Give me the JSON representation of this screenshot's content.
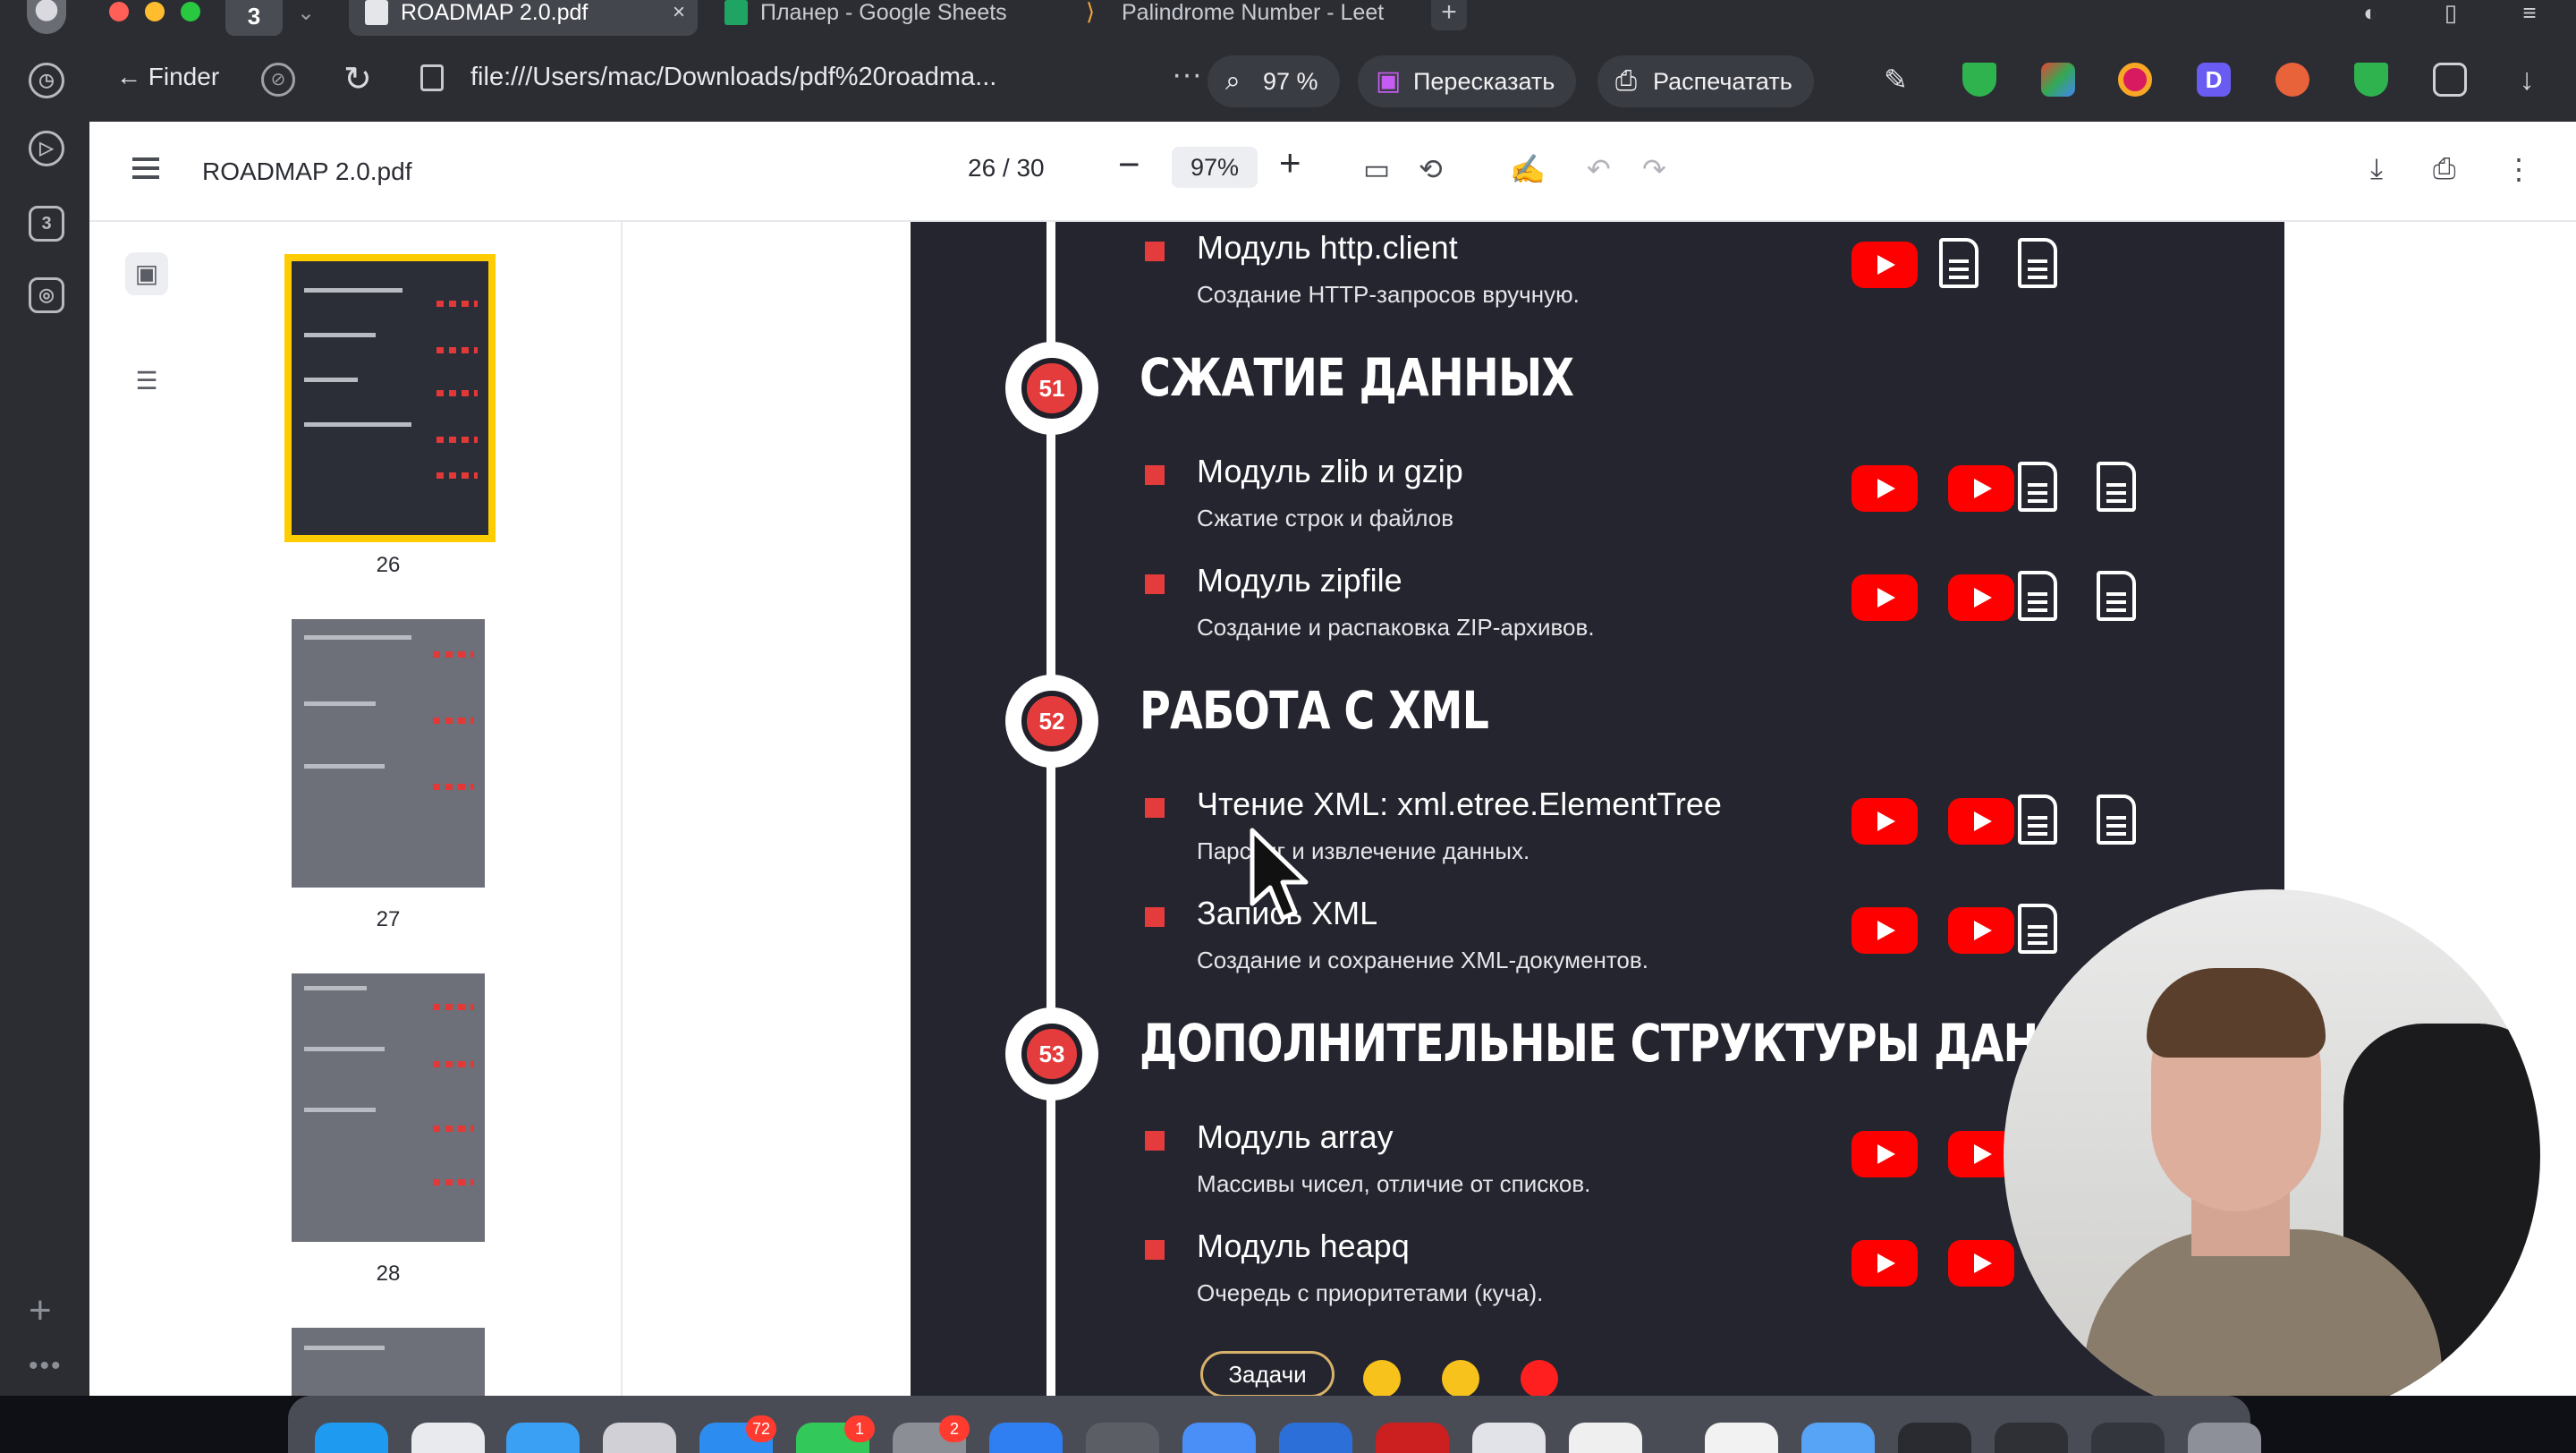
{
  "browser": {
    "tab_count": "3",
    "tabs": [
      {
        "label": "ROADMAP 2.0.pdf",
        "close": "×"
      },
      {
        "label": "Планер - Google Sheets"
      },
      {
        "label": "Palindrome Number - Leet"
      }
    ],
    "new_tab": "+",
    "back_label": "← Finder",
    "url": "file:///Users/mac/Downloads/pdf%20roadma...",
    "zoom_pill": "97 %",
    "retell_label": "Пересказать",
    "print_label": "Распечатать",
    "colors": {
      "accent_red": "#e43c3c",
      "youtube": "#ff0000",
      "thumb_highlight": "#ffcc00"
    }
  },
  "rail": {
    "items": [
      "history-icon",
      "play-icon",
      "3",
      "camera-icon"
    ],
    "add": "+",
    "more": "•••"
  },
  "viewer": {
    "doc_title": "ROADMAP 2.0.pdf",
    "page_indicator": "26 / 30",
    "zoom": "97%",
    "zoom_minus": "−",
    "zoom_plus": "+"
  },
  "thumbnails": [
    {
      "page": "26",
      "selected": true
    },
    {
      "page": "27",
      "selected": false
    },
    {
      "page": "28",
      "selected": false
    }
  ],
  "roadmap": {
    "top_item": {
      "title": "Модуль http.client",
      "desc": "Создание HTTP-запросов вручную."
    },
    "sections": [
      {
        "number": "51",
        "title": "СЖАТИЕ ДАННЫХ",
        "items": [
          {
            "title": "Модуль zlib и gzip",
            "desc": "Сжатие строк и файлов"
          },
          {
            "title": "Модуль zipfile",
            "desc": "Создание и распаковка ZIP-архивов."
          }
        ]
      },
      {
        "number": "52",
        "title": "РАБОТА С XML",
        "items": [
          {
            "title": "Чтение XML: xml.etree.ElementTree",
            "desc": "Парсинг и извлечение данных."
          },
          {
            "title": "Запись XML",
            "desc": "Создание и сохранение XML-документов."
          }
        ]
      },
      {
        "number": "53",
        "title": "ДОПОЛНИТЕЛЬНЫЕ СТРУКТУРЫ ДАННЫХ",
        "items": [
          {
            "title": "Модуль array",
            "desc": "Массивы чисел, отличие от списков."
          },
          {
            "title": "Модуль heapq",
            "desc": "Очередь с приоритетами (куча)."
          }
        ]
      }
    ],
    "tasks_label": "Задачи",
    "task_difficulty_colors": [
      "#f7c21c",
      "#f7c21c",
      "#ff1f1f"
    ]
  },
  "dock": {
    "badges": [
      "72",
      "1",
      "2"
    ]
  }
}
